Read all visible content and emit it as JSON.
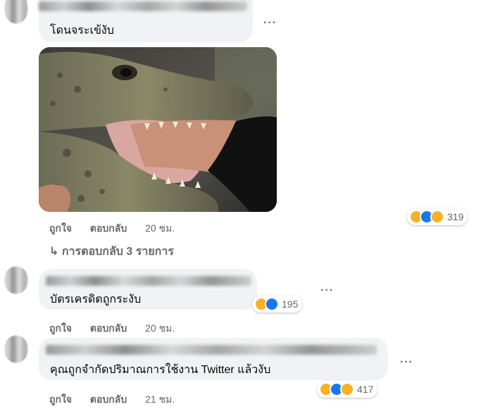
{
  "comments": [
    {
      "text": "โดนจระเข้งับ",
      "more_label": "···",
      "actions": {
        "like": "ถูกใจ",
        "reply": "ตอบกลับ",
        "time": "20 ชม."
      },
      "reactions": {
        "count": "319",
        "types": [
          "haha-icon",
          "like-icon",
          "sad-icon"
        ]
      },
      "replies_label": "การตอบกลับ 3 รายการ",
      "has_photo": true
    },
    {
      "text": "บัตรเครดิตถูกระงับ",
      "more_label": "···",
      "actions": {
        "like": "ถูกใจ",
        "reply": "ตอบกลับ",
        "time": "20 ชม."
      },
      "reactions": {
        "count": "195",
        "types": [
          "haha-icon",
          "like-icon"
        ]
      }
    },
    {
      "text": "คุณถูกจำกัดปริมาณการใช้งาน Twitter แล้วงับ",
      "more_label": "···",
      "actions": {
        "like": "ถูกใจ",
        "reply": "ตอบกลับ",
        "time": "21 ชม."
      },
      "reactions": {
        "count": "417",
        "types": [
          "haha-icon",
          "like-icon",
          "sad-icon"
        ]
      }
    }
  ],
  "colors": {
    "bubble": "#f0f2f5",
    "meta_text": "#65676b",
    "like_blue": "#1877f2",
    "haha_yellow": "#f7b125"
  }
}
